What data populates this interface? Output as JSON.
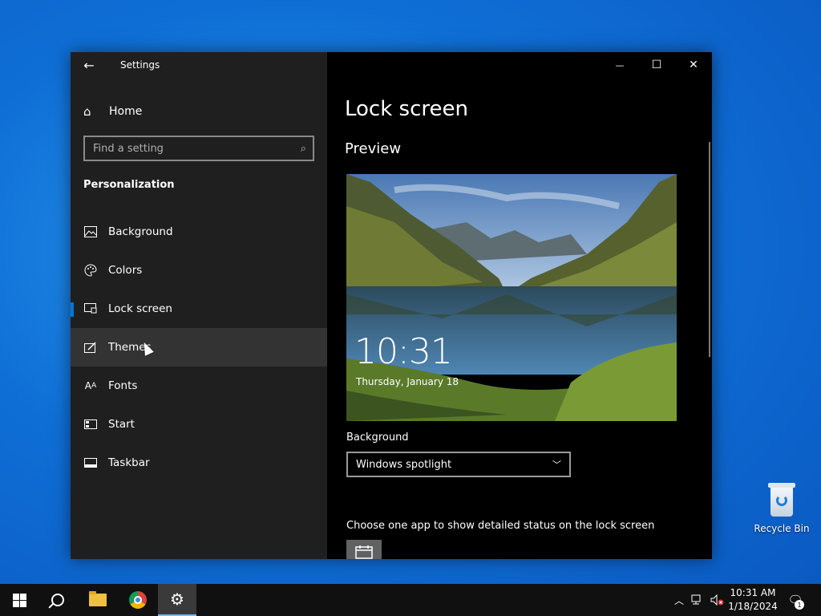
{
  "desktop": {
    "recycle_bin_label": "Recycle Bin"
  },
  "window": {
    "title": "Settings",
    "controls": {
      "minimize": "—",
      "maximize": "☐",
      "close": "✕"
    }
  },
  "sidebar": {
    "home_label": "Home",
    "search_placeholder": "Find a setting",
    "section_title": "Personalization",
    "items": [
      {
        "label": "Background",
        "icon": "image-icon"
      },
      {
        "label": "Colors",
        "icon": "palette-icon"
      },
      {
        "label": "Lock screen",
        "icon": "lock-screen-icon",
        "selected": true
      },
      {
        "label": "Themes",
        "icon": "themes-icon",
        "hovered": true
      },
      {
        "label": "Fonts",
        "icon": "fonts-icon"
      },
      {
        "label": "Start",
        "icon": "start-icon"
      },
      {
        "label": "Taskbar",
        "icon": "taskbar-icon"
      }
    ]
  },
  "main": {
    "page_title": "Lock screen",
    "preview_heading": "Preview",
    "preview_time": "10:31",
    "preview_date": "Thursday, January 18",
    "background_label": "Background",
    "background_value": "Windows spotlight",
    "status_label": "Choose one app to show detailed status on the lock screen"
  },
  "taskbar": {
    "clock_time": "10:31 AM",
    "clock_date": "1/18/2024",
    "notification_count": "1"
  },
  "colors": {
    "accent": "#0078d7",
    "sidebar_bg": "#1f1f1f",
    "main_bg": "#000000"
  }
}
